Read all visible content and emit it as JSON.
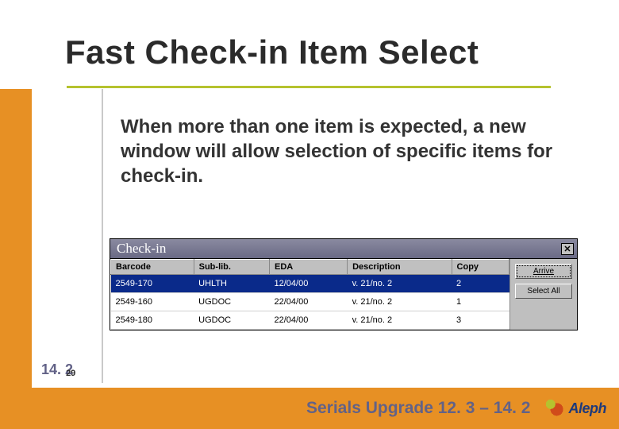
{
  "title": "Fast Check-in Item Select",
  "body": "When more than one item is expected, a new window will allow selection of specific items for check-in.",
  "dialog": {
    "title": "Check-in",
    "columns": [
      "Barcode",
      "Sub-lib.",
      "EDA",
      "Description",
      "Copy"
    ],
    "rows": [
      {
        "barcode": "2549-170",
        "sublib": "UHLTH",
        "eda": "12/04/00",
        "desc": "v. 21/no. 2",
        "copy": "2",
        "selected": true
      },
      {
        "barcode": "2549-160",
        "sublib": "UGDOC",
        "eda": "22/04/00",
        "desc": "v. 21/no. 2",
        "copy": "1",
        "selected": false
      },
      {
        "barcode": "2549-180",
        "sublib": "UGDOC",
        "eda": "22/04/00",
        "desc": "v. 21/no. 2",
        "copy": "3",
        "selected": false
      }
    ],
    "buttons": {
      "arrive": "Arrive",
      "select_all": "Select All"
    }
  },
  "slide_number": {
    "main": "14. 2",
    "sub": "29"
  },
  "footer": {
    "text": "Serials Upgrade 12. 3 – 14. 2",
    "logo": "Aleph"
  }
}
